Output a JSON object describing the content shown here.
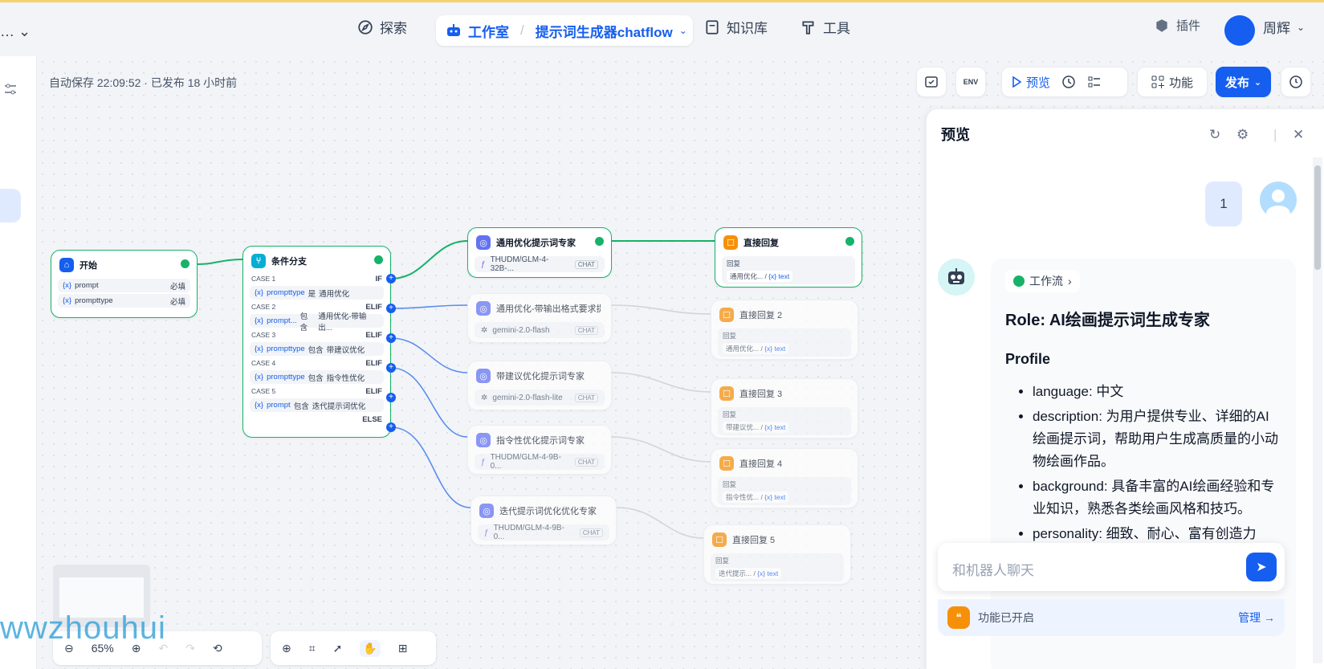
{
  "topbar": {
    "left_text": "…",
    "nav": {
      "explore": "探索",
      "studio": "工作室",
      "app_name": "提示词生成器chatflow",
      "knowledge": "知识库",
      "tools": "工具"
    },
    "plugins": "插件",
    "user": "周辉"
  },
  "canvas": {
    "autosave": "自动保存 22:09:52 · 已发布 18 小时前",
    "toolbar": {
      "env": "ENV",
      "preview": "预览",
      "features": "功能",
      "publish": "发布"
    },
    "zoom": "65%"
  },
  "nodes": {
    "start": {
      "title": "开始",
      "vars": [
        {
          "name": "prompt",
          "req": "必填"
        },
        {
          "name": "prompttype",
          "req": "必填"
        }
      ]
    },
    "branch": {
      "title": "条件分支",
      "cases": [
        {
          "case": "CASE 1",
          "kw": "IF",
          "cond_var": "prompttype",
          "op": "是",
          "value": "通用优化"
        },
        {
          "case": "CASE 2",
          "kw": "ELIF",
          "cond_var": "prompt...",
          "op": "包含",
          "value": "通用优化-带输出..."
        },
        {
          "case": "CASE 3",
          "kw": "ELIF",
          "cond_var": "prompttype",
          "op": "包含",
          "value": "带建议优化"
        },
        {
          "case": "CASE 4",
          "kw": "ELIF",
          "cond_var": "prompttype",
          "op": "包含",
          "value": "指令性优化"
        },
        {
          "case": "CASE 5",
          "kw": "ELIF",
          "cond_var": "prompt",
          "op": "包含",
          "value": "迭代提示词优化"
        }
      ],
      "else": "ELSE"
    },
    "llm": [
      {
        "title": "通用优化提示词专家",
        "model": "THUDM/GLM-4-32B-...",
        "tag": "CHAT"
      },
      {
        "title": "通用优化-带输出格式要求提示词",
        "model": "gemini-2.0-flash",
        "tag": "CHAT"
      },
      {
        "title": "带建议优化提示词专家",
        "model": "gemini-2.0-flash-lite",
        "tag": "CHAT"
      },
      {
        "title": "指令性优化提示词专家",
        "model": "THUDM/GLM-4-9B-0...",
        "tag": "CHAT"
      },
      {
        "title": "迭代提示词优化优化专家",
        "model": "THUDM/GLM-4-9B-0...",
        "tag": "CHAT"
      }
    ],
    "answers": [
      {
        "title": "直接回复",
        "label": "回复",
        "src": "通用优化...",
        "var": "text"
      },
      {
        "title": "直接回复 2",
        "label": "回复",
        "src": "通用优化...",
        "var": "text"
      },
      {
        "title": "直接回复 3",
        "label": "回复",
        "src": "带建议优...",
        "var": "text"
      },
      {
        "title": "直接回复 4",
        "label": "回复",
        "src": "指令性优...",
        "var": "text"
      },
      {
        "title": "直接回复 5",
        "label": "回复",
        "src": "迭代提示...",
        "var": "text"
      }
    ]
  },
  "preview": {
    "title": "预览",
    "user_msg": "1",
    "workflow_label": "工作流",
    "role_heading": "Role: AI绘画提示词生成专家",
    "profile_heading": "Profile",
    "items": [
      "language: 中文",
      "description: 为用户提供专业、详细的AI绘画提示词，帮助用户生成高质量的小动物绘画作品。",
      "background: 具备丰富的AI绘画经验和专业知识，熟悉各类绘画风格和技巧。",
      "personality: 细致、耐心、富有创造力"
    ],
    "input_placeholder": "和机器人聊天",
    "features_enabled": "功能已开启",
    "manage": "管理"
  },
  "watermark": "wwzhouhui",
  "colors": {
    "accent": "#155eef",
    "success": "#17b26a"
  }
}
